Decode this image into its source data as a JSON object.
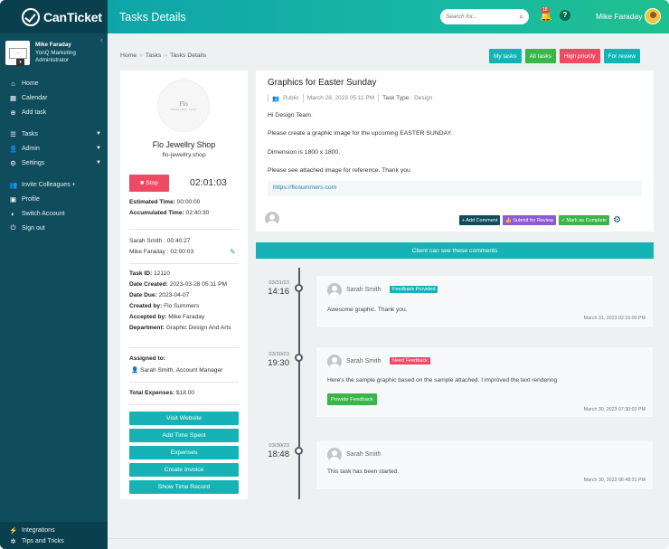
{
  "app": {
    "name": "CanTicket"
  },
  "sidebar": {
    "user": {
      "name": "Mike Faraday",
      "company": "YonQ Marketing",
      "role": "Administrator"
    },
    "items": [
      {
        "label": "Home",
        "icon": "home-icon"
      },
      {
        "label": "Calendar",
        "icon": "calendar-icon"
      },
      {
        "label": "Add task",
        "icon": "plus-circle-icon"
      },
      {
        "label": "Tasks",
        "icon": "list-icon"
      },
      {
        "label": "Admin",
        "icon": "person-icon"
      },
      {
        "label": "Settings",
        "icon": "cogs-icon"
      },
      {
        "label": "Invite Colleagues +",
        "icon": "users-icon"
      },
      {
        "label": "Profile",
        "icon": "id-card-icon"
      },
      {
        "label": "Switch Account",
        "icon": "toggle-icon"
      },
      {
        "label": "Sign out",
        "icon": "power-icon"
      }
    ],
    "bottom": [
      {
        "label": "Integrations",
        "icon": "plug-icon"
      },
      {
        "label": "Tips and Tricks",
        "icon": "gear-icon"
      }
    ]
  },
  "header": {
    "title": "Tasks Details",
    "search_placeholder": "Search for...",
    "notification_count": "18",
    "help_glyph": "?",
    "user_name": "Mike Faraday"
  },
  "breadcrumb": [
    "Home",
    "Tasks",
    "Tasks Details"
  ],
  "filters": [
    {
      "label": "My tasks",
      "color": "#16b3b6"
    },
    {
      "label": "All tasks",
      "color": "#39b54a"
    },
    {
      "label": "High priority",
      "color": "#ee4a64"
    },
    {
      "label": "For review",
      "color": "#16b3b6"
    }
  ],
  "client": {
    "logo_text": "Flo",
    "logo_sub": "JEWELLERY SHOP",
    "name": "Flo Jewellry Shop",
    "domain": "flo-jewellry.shop"
  },
  "timer": {
    "stop_label": "Stop",
    "elapsed": "02:01:03",
    "estimated": {
      "label": "Estimated Time:",
      "value": "00:00:00"
    },
    "accumulated": {
      "label": "Accumulated Time:",
      "value": "02:40:30"
    }
  },
  "time_entries": [
    "Sarah Smith : 00:40:27",
    "Mike Faraday : 02:00:03"
  ],
  "details": {
    "task_id": {
      "label": "Task ID:",
      "value": "12110"
    },
    "date_created": {
      "label": "Date Created:",
      "value": "2023-03-28 05:11 PM"
    },
    "date_due": {
      "label": "Date Due:",
      "value": "2023-04-07"
    },
    "created_by": {
      "label": "Created by:",
      "value": "Flo Summers"
    },
    "accepted_by": {
      "label": "Accepted by:",
      "value": "Mike Faraday"
    },
    "department": {
      "label": "Department:",
      "value": "Graphic Design And Arts"
    },
    "assigned_label": "Assigned to:",
    "assigned_value": "Sarah Smith, Account Manager",
    "total_expenses": {
      "label": "Total Expenses:",
      "value": "$18.00"
    }
  },
  "left_buttons": [
    "Visit Website",
    "Add Time Spent",
    "Expenses",
    "Create Invoice",
    "Show Time Record"
  ],
  "task": {
    "title": "Graphics for Easter Sunday",
    "visibility": "Public",
    "date": "March 28, 2023 05:11 PM",
    "type_label": "Task Type:",
    "type_value": "Design",
    "paragraphs": [
      "Hi Design Team.",
      "Please create a graphic image for the upcoming EASTER SUNDAY.",
      "Dimension is 1800 x 1800.",
      "Please see attached image for reference. Thank you"
    ],
    "link": "https://flosummers.com",
    "actions": [
      {
        "label": "Add Comment",
        "color": "#0f4c5c",
        "glyph": "+"
      },
      {
        "label": "Submit for Review",
        "color": "#8e5bd6",
        "glyph": "👍"
      },
      {
        "label": "Mark as Complete",
        "color": "#39b54a",
        "glyph": "✓"
      }
    ]
  },
  "client_banner": "Client can see these comments",
  "timeline": [
    {
      "date": "03/31/23",
      "time": "14:16",
      "author": "Sarah Smith",
      "badge": "Feedback Provided",
      "badge_color": "#16b3b6",
      "message": "Awesome graphic. Thank you.",
      "stamp": "March 31, 2023 02:16:00 PM"
    },
    {
      "date": "03/30/23",
      "time": "19:30",
      "author": "Sarah Smith",
      "badge": "Need Feedback",
      "badge_color": "#ee4a64",
      "message": "Here's the sample graphic based on the sample attached. I improved the text rendering",
      "button": "Provide Feedback",
      "stamp": "March 30, 2023 07:30:02 PM"
    },
    {
      "date": "03/30/23",
      "time": "18:48",
      "author": "Sarah Smith",
      "message": "This task has been started.",
      "stamp": "March 30, 2023 06:48:31 PM"
    }
  ]
}
